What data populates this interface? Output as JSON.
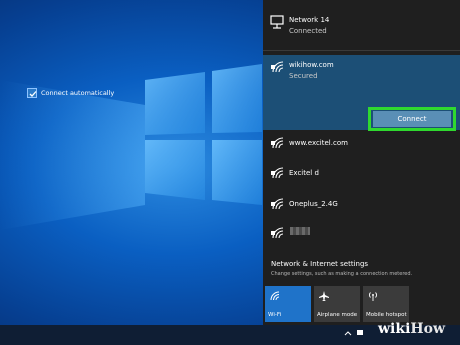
{
  "flyout": {
    "networks": [
      {
        "name": "Network 14",
        "status": "Connected",
        "icon": "ethernet-icon"
      },
      {
        "name": "wikihow.com",
        "status": "Secured",
        "icon": "wifi-secured-icon"
      },
      {
        "name": "www.excitel.com",
        "icon": "wifi-secured-icon"
      },
      {
        "name": "Excitel d",
        "icon": "wifi-secured-icon"
      },
      {
        "name": "Oneplus_2.4G",
        "icon": "wifi-secured-icon"
      }
    ],
    "connect_automatically_label": "Connect automatically",
    "connect_automatically_checked": true,
    "connect_button": "Connect",
    "settings_title": "Network & Internet settings",
    "settings_subtitle": "Change settings, such as making a connection metered.",
    "quick_actions": [
      {
        "label": "Wi-Fi",
        "icon": "wifi-icon",
        "active": true
      },
      {
        "label": "Airplane mode",
        "icon": "airplane-icon",
        "active": false
      },
      {
        "label": "Mobile hotspot",
        "icon": "hotspot-icon",
        "active": false
      }
    ]
  },
  "watermark": {
    "wiki": "wiki",
    "how": "How"
  },
  "colors": {
    "selected": "#1c4f76",
    "highlight": "#2fd92f",
    "tile_active": "#1f73c9"
  }
}
